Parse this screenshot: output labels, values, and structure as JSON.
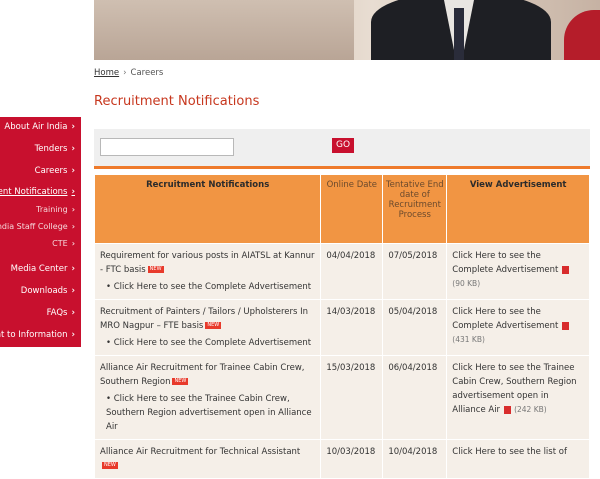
{
  "breadcrumb": {
    "home": "Home",
    "sep": "›",
    "current": "Careers"
  },
  "page_title": "Recruitment Notifications",
  "search": {
    "go_label": "GO",
    "value": ""
  },
  "sidebar": {
    "items": [
      {
        "label": "About Air India",
        "chev": "›"
      },
      {
        "label": "Tenders",
        "chev": "›"
      },
      {
        "label": "Careers",
        "chev": "›"
      },
      {
        "label": "ment Notifications",
        "chev": "›"
      },
      {
        "label": "Training",
        "chev": "›"
      },
      {
        "label": "India Staff College",
        "chev": "›"
      },
      {
        "label": "CTE",
        "chev": "›"
      },
      {
        "label": "Media Center",
        "chev": "›"
      },
      {
        "label": "Downloads",
        "chev": "›"
      },
      {
        "label": "FAQs",
        "chev": "›"
      },
      {
        "label": "ght to Information",
        "chev": "›"
      }
    ]
  },
  "table": {
    "headers": [
      "Recruitment Notifications",
      "Online Date",
      "Tentative End date of Recruitment Process",
      "View Advertisement"
    ],
    "new_badge": "NEW",
    "rows": [
      {
        "title": "Requirement for various posts in AIATSL at Kannur - FTC basis",
        "link": "Click Here to see the Complete Advertisement",
        "online": "04/04/2018",
        "end": "07/05/2018",
        "adv": "Click Here to see the Complete Advertisement",
        "size": "(90 KB)"
      },
      {
        "title": "Recruitment of Painters / Tailors / Upholsterers In MRO Nagpur – FTE basis",
        "link": "Click Here to see the Complete Advertisement",
        "online": "14/03/2018",
        "end": "05/04/2018",
        "adv": "Click Here to see the Complete Advertisement",
        "size": "(431 KB)"
      },
      {
        "title": "Alliance Air Recruitment for Trainee Cabin Crew, Southern Region",
        "link": "Click Here to see the Trainee Cabin Crew, Southern Region advertisement open in Alliance Air",
        "online": "15/03/2018",
        "end": "06/04/2018",
        "adv": "Click Here to see the Trainee Cabin Crew, Southern Region advertisement open in Alliance Air",
        "size": "(242 KB)"
      },
      {
        "title": "Alliance Air Recruitment for Technical Assistant",
        "link": "",
        "online": "10/03/2018",
        "end": "10/04/2018",
        "adv": "Click Here to see the list of",
        "size": ""
      }
    ]
  },
  "colors": {
    "accent": "#c8102e",
    "header_orange": "#f19543",
    "title_red": "#c7371e"
  }
}
